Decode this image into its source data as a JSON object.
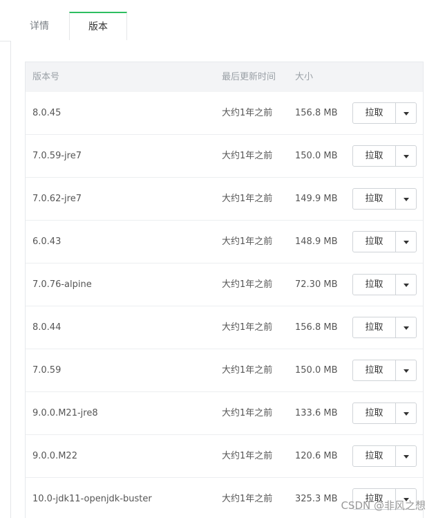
{
  "tabs": [
    {
      "label": "详情"
    },
    {
      "label": "版本"
    }
  ],
  "table": {
    "headers": {
      "tag": "版本号",
      "updated": "最后更新时间",
      "size": "大小"
    },
    "pull_label": "拉取",
    "rows": [
      {
        "tag": "8.0.45",
        "updated": "大约1年之前",
        "size": "156.8 MB"
      },
      {
        "tag": "7.0.59-jre7",
        "updated": "大约1年之前",
        "size": "150.0 MB"
      },
      {
        "tag": "7.0.62-jre7",
        "updated": "大约1年之前",
        "size": "149.9 MB"
      },
      {
        "tag": "6.0.43",
        "updated": "大约1年之前",
        "size": "148.9 MB"
      },
      {
        "tag": "7.0.76-alpine",
        "updated": "大约1年之前",
        "size": "72.30 MB"
      },
      {
        "tag": "8.0.44",
        "updated": "大约1年之前",
        "size": "156.8 MB"
      },
      {
        "tag": "7.0.59",
        "updated": "大约1年之前",
        "size": "150.0 MB"
      },
      {
        "tag": "9.0.0.M21-jre8",
        "updated": "大约1年之前",
        "size": "133.6 MB"
      },
      {
        "tag": "9.0.0.M22",
        "updated": "大约1年之前",
        "size": "120.6 MB"
      },
      {
        "tag": "10.0-jdk11-openjdk-buster",
        "updated": "大约1年之前",
        "size": "325.3 MB"
      }
    ]
  },
  "watermark": "CSDN @非风之想",
  "colors": {
    "accent": "#2dbe60",
    "header_bg": "#f3f4f6"
  }
}
